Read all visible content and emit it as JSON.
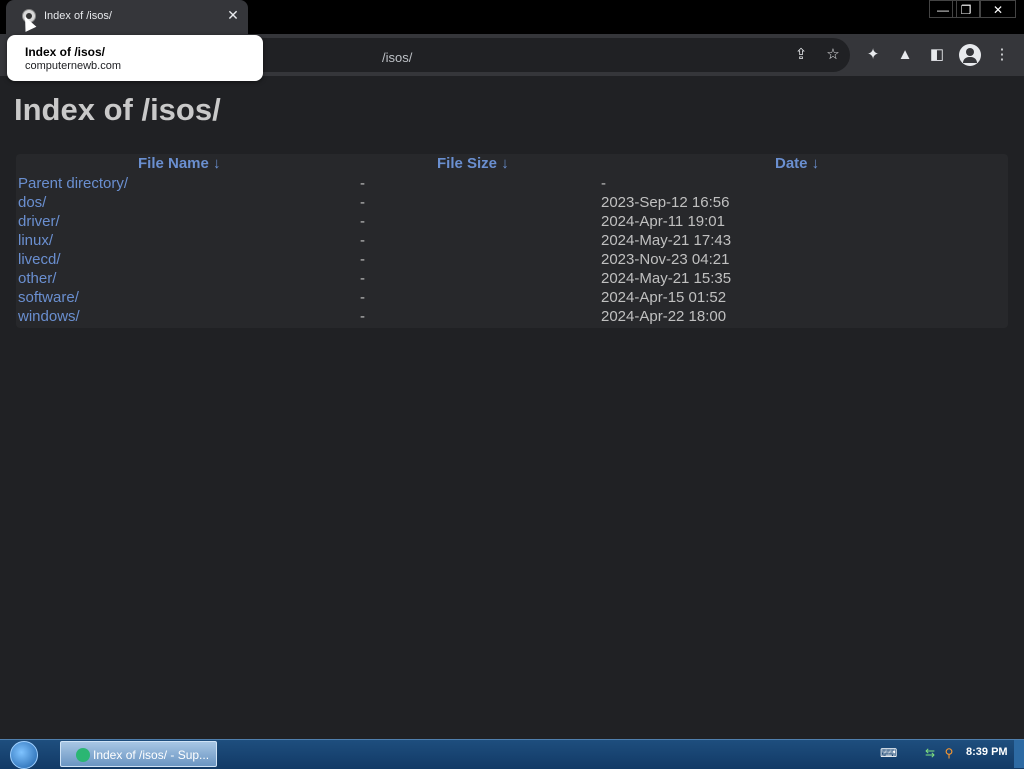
{
  "browser": {
    "tab_title": "Index of /isos/",
    "tab_close_glyph": "✕",
    "address_text": "/isos/",
    "window_controls": {
      "minimize": "—",
      "restore": "❐",
      "close": "✕"
    },
    "toolbar_icons": {
      "share": "⇪",
      "bookmark": "☆",
      "extensions": "✦",
      "labs": "▲",
      "side_panel": "◧",
      "menu": "⋮"
    },
    "tooltip": {
      "title": "Index of /isos/",
      "host": "computernewb.com"
    }
  },
  "page": {
    "heading": "Index of /isos/",
    "columns": {
      "name": "File Name  ↓",
      "size": "File Size  ↓",
      "date": "Date  ↓"
    },
    "rows": [
      {
        "name": "Parent directory/",
        "size": "-",
        "date": "-"
      },
      {
        "name": "dos/",
        "size": "-",
        "date": "2023-Sep-12 16:56"
      },
      {
        "name": "driver/",
        "size": "-",
        "date": "2024-Apr-11 19:01"
      },
      {
        "name": "linux/",
        "size": "-",
        "date": "2024-May-21 17:43"
      },
      {
        "name": "livecd/",
        "size": "-",
        "date": "2023-Nov-23 04:21"
      },
      {
        "name": "other/",
        "size": "-",
        "date": "2024-May-21 15:35"
      },
      {
        "name": "software/",
        "size": "-",
        "date": "2024-Apr-15 01:52"
      },
      {
        "name": "windows/",
        "size": "-",
        "date": "2024-Apr-22 18:00"
      }
    ]
  },
  "taskbar": {
    "task_label": "Index of /isos/ - Sup...",
    "clock": "8:39 PM",
    "tray": {
      "keyboard": "⌨",
      "network": "⇆",
      "search": "⚲"
    }
  },
  "colors": {
    "page_bg": "#202124",
    "link": "#6a8fd0",
    "text": "#c0c0c0",
    "heading": "#c9c9c9"
  }
}
